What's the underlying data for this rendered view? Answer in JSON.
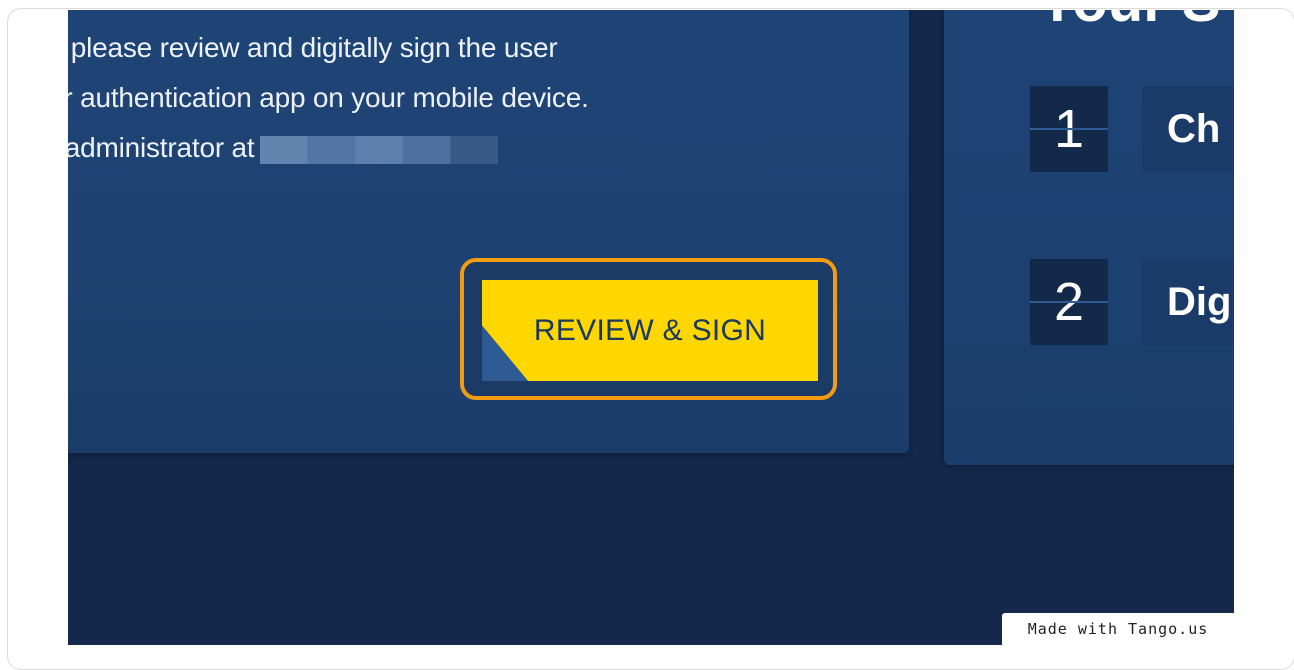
{
  "instructions": {
    "line1": "r, please review and digitally sign the user",
    "line2": "er authentication app on your mobile device.",
    "line3": "r administrator at"
  },
  "button": {
    "label": "REVIEW & SIGN"
  },
  "steps_panel": {
    "heading": "Your S",
    "steps": [
      {
        "number": "1",
        "label": "Ch"
      },
      {
        "number": "2",
        "label": "Dig"
      }
    ]
  },
  "badge": {
    "text": "Made with Tango.us"
  },
  "colors": {
    "accent_button": "#fed700",
    "highlight_border": "#f39c12",
    "background": "#13284a",
    "card": "#1e4476"
  }
}
